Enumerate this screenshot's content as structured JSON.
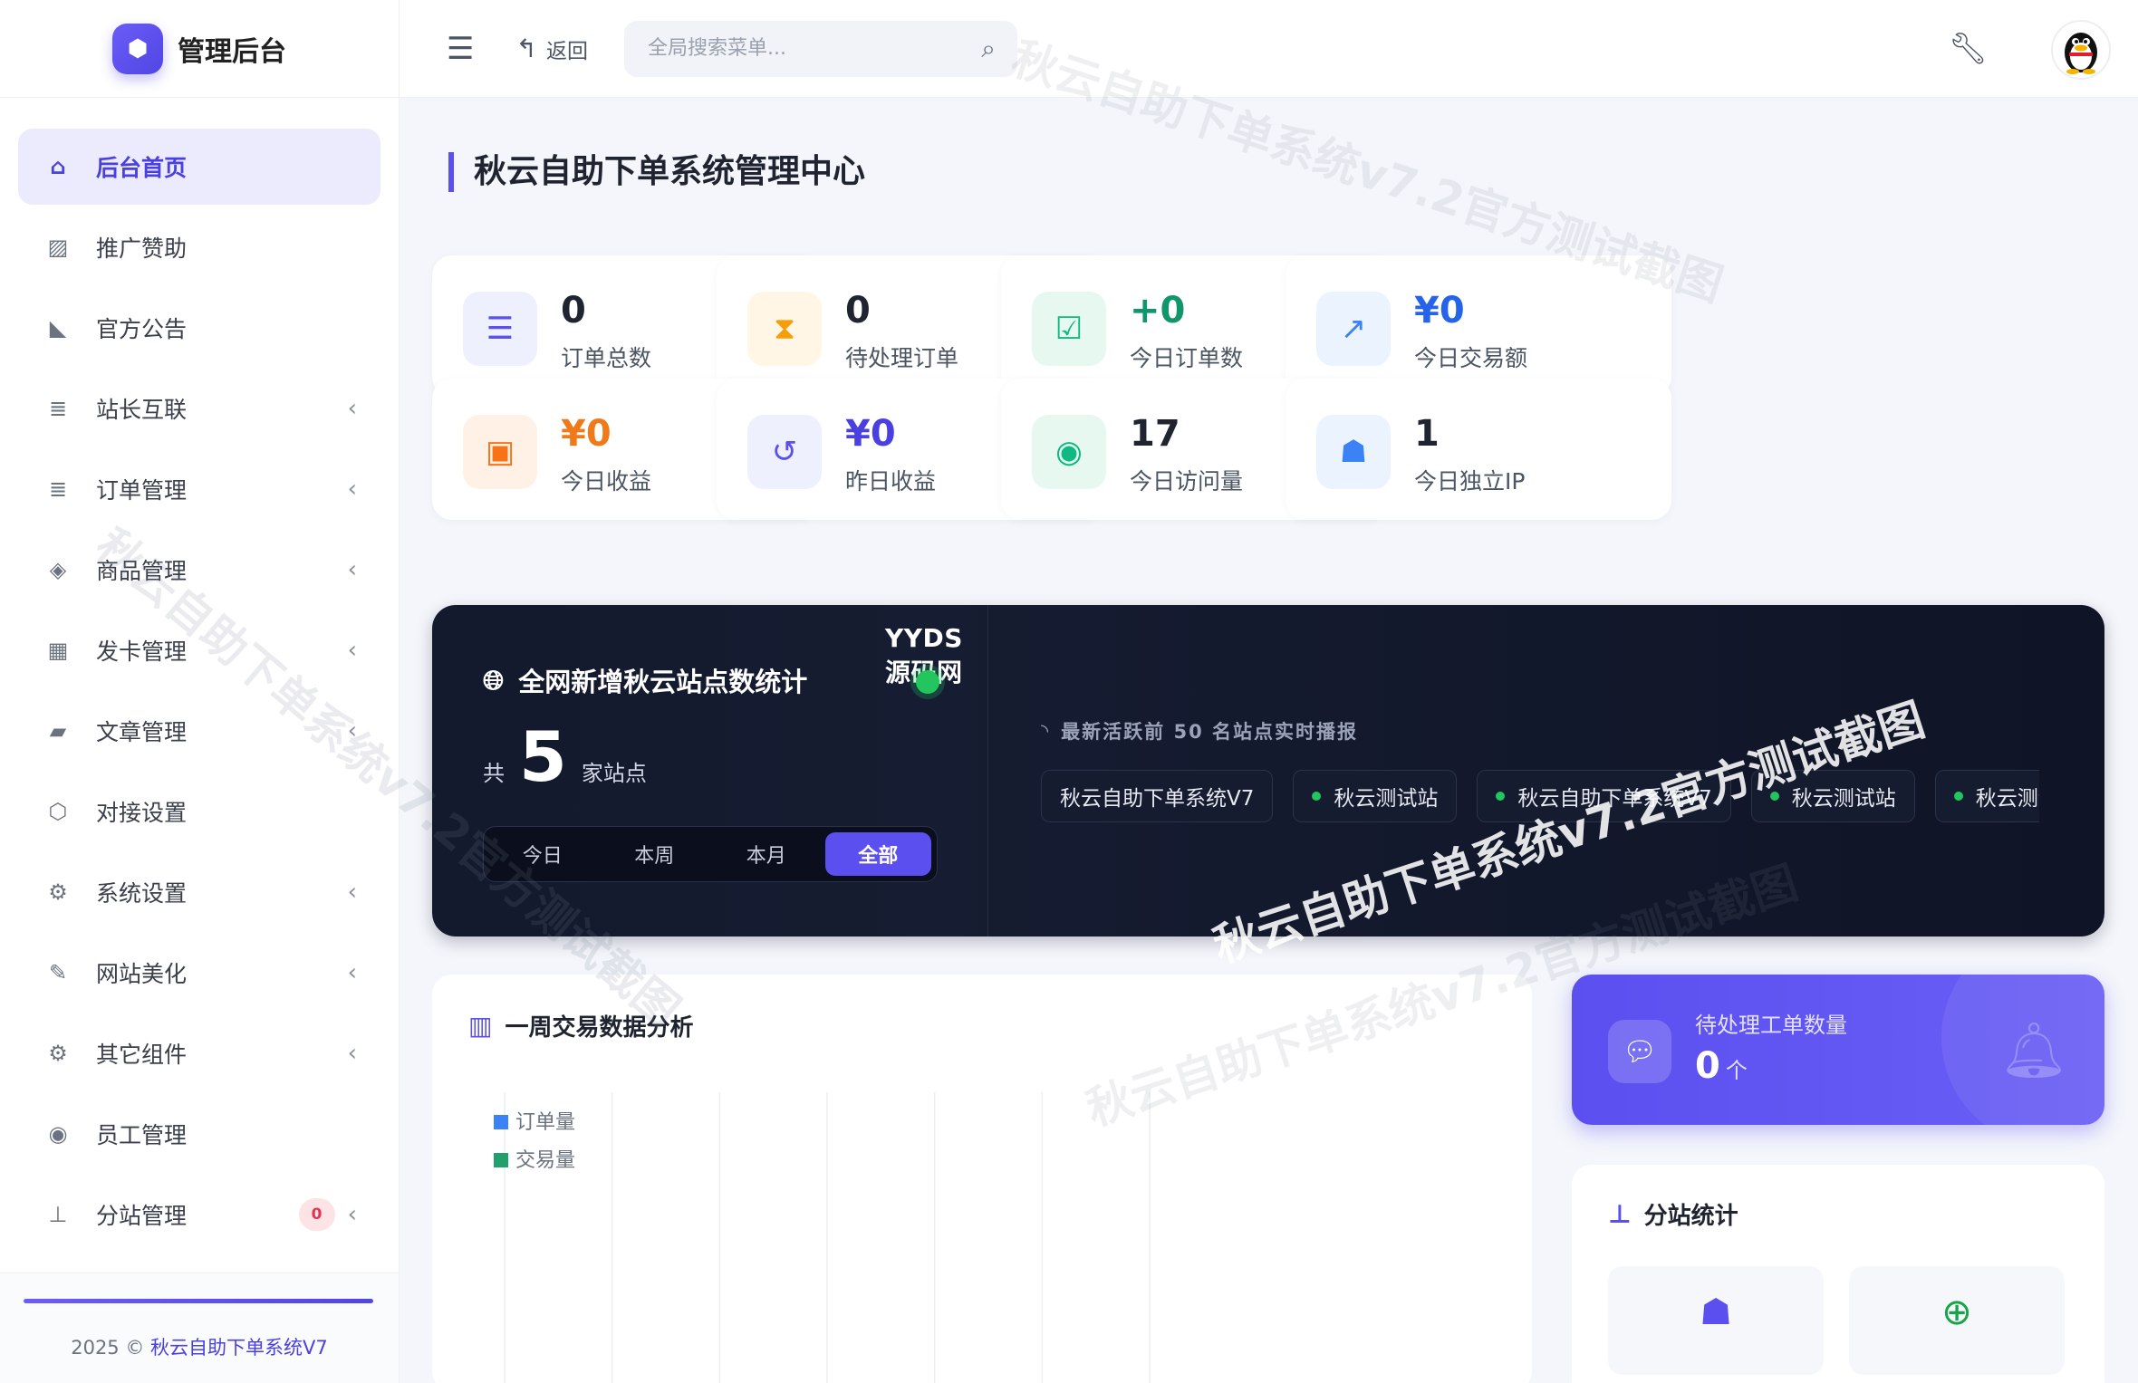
{
  "brand": {
    "title": "管理后台"
  },
  "sidebar": {
    "items": [
      {
        "label": "后台首页",
        "icon": "home-icon",
        "glyph": "⌂",
        "active": true
      },
      {
        "label": "推广赞助",
        "icon": "image-icon",
        "glyph": "▨"
      },
      {
        "label": "官方公告",
        "icon": "megaphone-icon",
        "glyph": "◣"
      },
      {
        "label": "站长互联",
        "icon": "list-icon",
        "glyph": "≣",
        "chevron": true
      },
      {
        "label": "订单管理",
        "icon": "list-icon",
        "glyph": "≣",
        "chevron": true
      },
      {
        "label": "商品管理",
        "icon": "tags-icon",
        "glyph": "◈",
        "chevron": true
      },
      {
        "label": "发卡管理",
        "icon": "grid-icon",
        "glyph": "▦",
        "chevron": true
      },
      {
        "label": "文章管理",
        "icon": "book-icon",
        "glyph": "▰",
        "chevron": true
      },
      {
        "label": "对接设置",
        "icon": "cubes-icon",
        "glyph": "⬡",
        "chevron": false
      },
      {
        "label": "系统设置",
        "icon": "gear-icon",
        "glyph": "⚙",
        "chevron": true
      },
      {
        "label": "网站美化",
        "icon": "brush-icon",
        "glyph": "✎",
        "chevron": true
      },
      {
        "label": "其它组件",
        "icon": "cogs-icon",
        "glyph": "⚙",
        "chevron": true
      },
      {
        "label": "员工管理",
        "icon": "user-circle-icon",
        "glyph": "◉"
      },
      {
        "label": "分站管理",
        "icon": "sitemap-icon",
        "glyph": "⊥",
        "chevron": true,
        "badge": "0"
      }
    ]
  },
  "footer": {
    "year": "2025 ©",
    "brand": "秋云自助下单系统V7"
  },
  "topbar": {
    "back_label": "返回",
    "search_placeholder": "全局搜索菜单..."
  },
  "page": {
    "title": "秋云自助下单系统管理中心"
  },
  "stats": [
    {
      "value": "0",
      "label": "订单总数",
      "icon": "list-ol-icon",
      "glyph": "☰",
      "color": "#5b4ff0",
      "bg": "#eef0fe",
      "valueColor": "#1f2430"
    },
    {
      "value": "0",
      "label": "待处理订单",
      "icon": "hourglass-icon",
      "glyph": "⧗",
      "color": "#f59e0b",
      "bg": "#fff6e5",
      "valueColor": "#1f2430"
    },
    {
      "value": "+0",
      "label": "今日订单数",
      "icon": "calendar-check-icon",
      "glyph": "☑",
      "color": "#10b981",
      "bg": "#e7f8f1",
      "valueColor": "#10966a"
    },
    {
      "value": "¥0",
      "label": "今日交易额",
      "icon": "chart-line-icon",
      "glyph": "↗",
      "color": "#3b82f6",
      "bg": "#eaf3fe",
      "valueColor": "#2563eb"
    },
    {
      "value": "¥0",
      "label": "今日收益",
      "icon": "money-bill-icon",
      "glyph": "▣",
      "color": "#f97316",
      "bg": "#fff1e6",
      "valueColor": "#f07a1a"
    },
    {
      "value": "¥0",
      "label": "昨日收益",
      "icon": "history-icon",
      "glyph": "↺",
      "color": "#5b4ff0",
      "bg": "#eef0fe",
      "valueColor": "#4a3fe0"
    },
    {
      "value": "17",
      "label": "今日访问量",
      "icon": "eye-icon",
      "glyph": "◉",
      "color": "#10b981",
      "bg": "#e7f8f1",
      "valueColor": "#1f2430"
    },
    {
      "value": "1",
      "label": "今日独立IP",
      "icon": "users-icon",
      "glyph": "☗",
      "color": "#3b82f6",
      "bg": "#eaf3fe",
      "valueColor": "#1f2430"
    }
  ],
  "banner": {
    "title": "全网新增秋云站点数统计",
    "total_prefix": "共",
    "total_value": "5",
    "total_suffix": "家站点",
    "tabs": [
      "今日",
      "本周",
      "本月",
      "全部"
    ],
    "active_tab": "全部",
    "overlay_text": "YYDS源码网",
    "broadcast_label": "最新活跃前 50 名站点实时播报",
    "sites": [
      "秋云自助下单系统V7",
      "秋云测试站",
      "秋云自助下单系统V7",
      "秋云测试站",
      "秋云测试站"
    ]
  },
  "chart": {
    "title": "一周交易数据分析"
  },
  "chart_data": {
    "type": "line",
    "title": "一周交易数据分析",
    "series": [
      {
        "name": "订单量",
        "color": "#3b82f6",
        "values": [
          0,
          0,
          0,
          0,
          0,
          0,
          0
        ]
      },
      {
        "name": "交易量",
        "color": "#22a06b",
        "values": [
          0,
          0,
          0,
          0,
          0,
          0,
          0
        ]
      }
    ],
    "grid": true,
    "legend": "top-left"
  },
  "ticket": {
    "label": "待处理工单数量",
    "value": "0",
    "unit": "个"
  },
  "branch": {
    "title": "分站统计"
  },
  "watermarks": [
    "秋云自助下单系统v7.2官方测试截图",
    "秋云自助下单系统v7.2官方测试截图",
    "秋云自助下单系统v7.2官方测试截图",
    "秋云自助下单系统v7.2官方测试截图"
  ]
}
